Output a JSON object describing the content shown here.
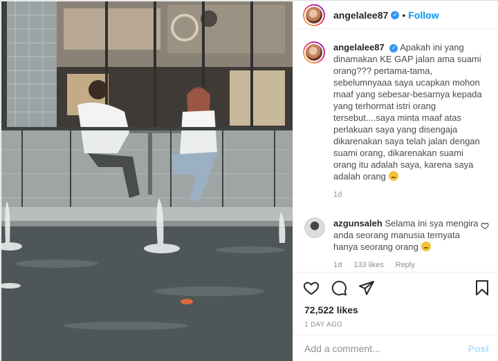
{
  "header": {
    "username": "angelalee87",
    "separator": "•",
    "follow_label": "Follow"
  },
  "caption": {
    "username": "angelalee87",
    "text": "Apakah ini yang dinamakan KE GAP jalan ama suami orang??? pertama-tama, sebelumnyaaa saya ucapkan mohon maaf yang sebesar-besarnya kepada yang terhormat istri orang tersebut....saya minta maaf atas perlakuan saya yang disengaja dikarenakan saya telah jalan dengan suami orang, dikarenakan suami orang itu adalah saya, karena saya adalah orang",
    "age": "1d"
  },
  "reply": {
    "username": "azgunsaleh",
    "text": "Selama ini sya mengira anda seorang manusia ternyata hanya seorang orang",
    "age": "1d",
    "likes": "133 likes",
    "reply_label": "Reply"
  },
  "post": {
    "likes": "72,522 likes",
    "time": "1 DAY AGO"
  },
  "composer": {
    "placeholder": "Add a comment...",
    "post_label": "Post"
  },
  "icons": {
    "like": "heart-icon",
    "comment": "comment-icon",
    "share": "share-icon",
    "save": "bookmark-icon",
    "verified": "verified-badge-icon"
  },
  "colors": {
    "accent": "#0095f6",
    "post_disabled": "#b2dffc",
    "verified": "#3897f0"
  }
}
